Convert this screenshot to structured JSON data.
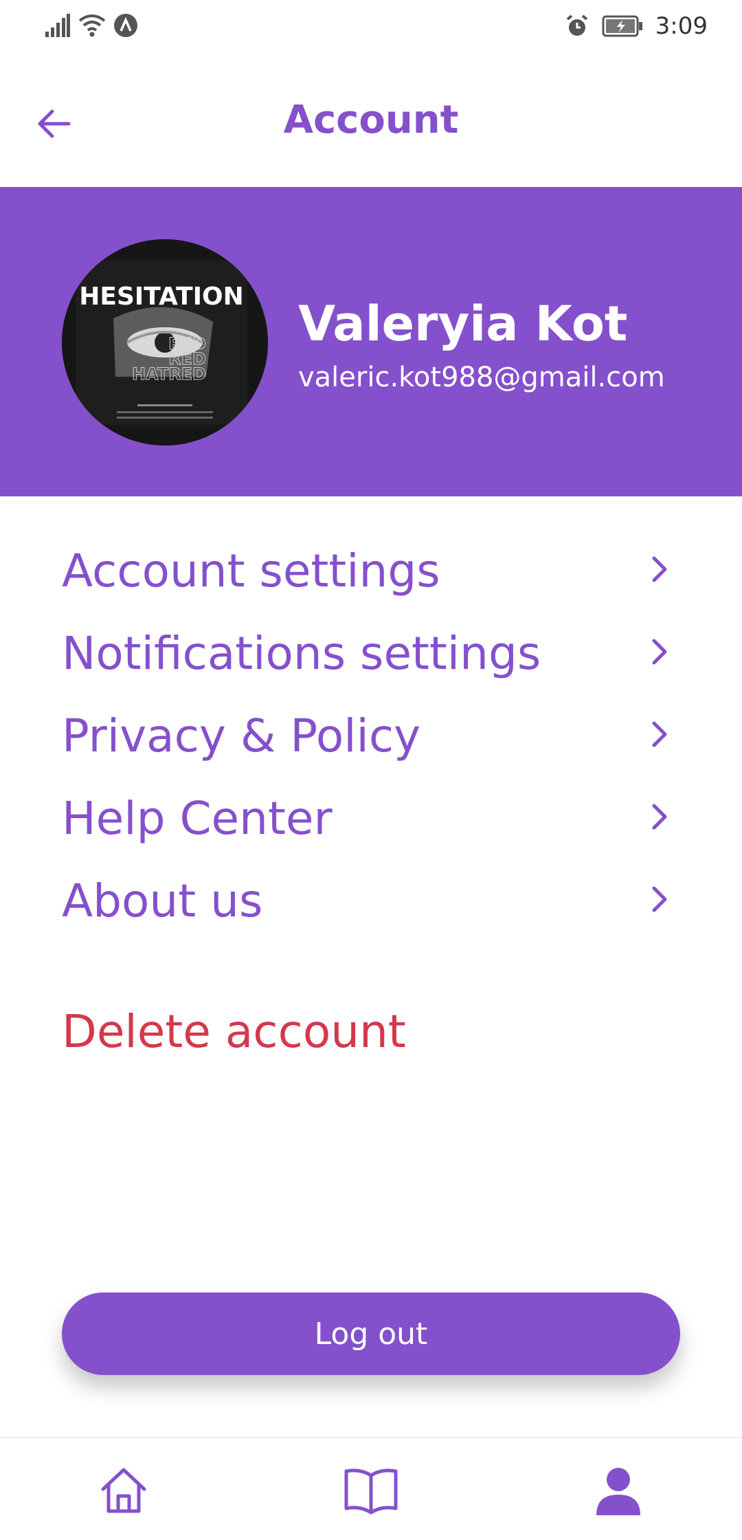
{
  "status_bar": {
    "time": "3:09",
    "icons": [
      "signal-icon",
      "wifi-icon",
      "vpn-icon",
      "alarm-icon",
      "battery-charging-icon"
    ]
  },
  "header": {
    "title": "Account",
    "back_icon": "arrow-left-icon"
  },
  "profile": {
    "name": "Valeryia Kot",
    "email": "valeric.kot988@gmail.com",
    "avatar_title": "HESITATION",
    "avatar_words": [
      "RED",
      "RED",
      "HATRED"
    ]
  },
  "menu": {
    "items": [
      {
        "label": "Account settings"
      },
      {
        "label": "Notifications settings"
      },
      {
        "label": "Privacy & Policy"
      },
      {
        "label": "Help Center"
      },
      {
        "label": "About us"
      }
    ],
    "delete_label": "Delete account"
  },
  "logout": {
    "label": "Log out"
  },
  "bottom_nav": {
    "items": [
      {
        "icon": "home-icon",
        "active": false
      },
      {
        "icon": "book-icon",
        "active": false
      },
      {
        "icon": "person-icon",
        "active": true
      }
    ]
  },
  "colors": {
    "accent": "#8550CC",
    "danger": "#D5384B",
    "background": "#FFFFFF"
  }
}
